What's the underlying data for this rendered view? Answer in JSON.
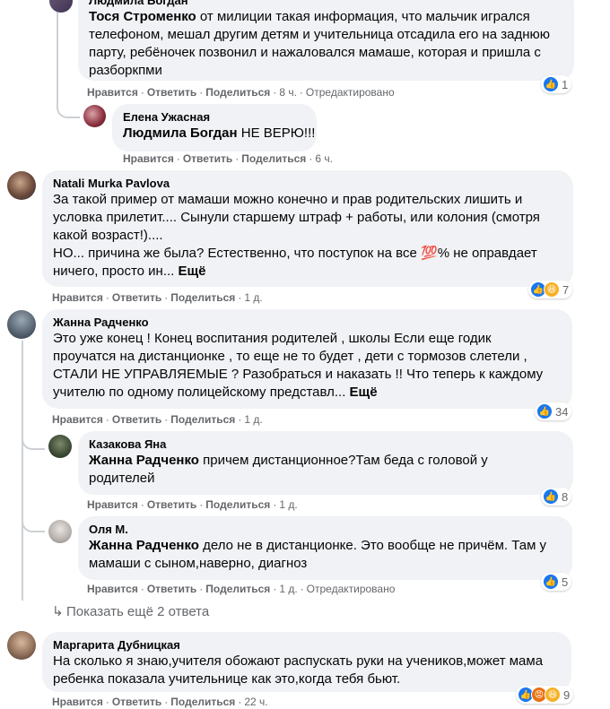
{
  "comments": [
    {
      "author": "Людмила Богдан",
      "mention": "Тося Строменко",
      "lines": [
        " от милиции такая информация, что мальчик игрался",
        "телефоном, мешал другим детям и учительница отсадила его на заднюю",
        "парту, ребёночек позвонил и нажаловался мамаше, которая и пришла с",
        "разборкпми"
      ],
      "actions": {
        "like": "Нравится",
        "reply": "Ответить",
        "share": "Поделиться",
        "time": "8 ч.",
        "edited": "Отредактировано"
      },
      "reactions": {
        "count": "1"
      }
    },
    {
      "author": "Елена Ужасная",
      "mention": "Людмила Богдан",
      "lines": [
        " НЕ ВЕРЮ!!!"
      ],
      "actions": {
        "like": "Нравится",
        "reply": "Ответить",
        "share": "Поделиться",
        "time": "6 ч."
      }
    },
    {
      "author": "Natali Murka Pavlova",
      "lines": [
        "За такой пример от мамаши можно конечно и прав родительских лишить и",
        "условка прилетит.... Сынули старшему штраф + работы, или колония (смотря",
        "какой возраст!)....",
        "НО... причина же была? Естественно, что поступок на все ",
        "% не оправдает",
        "ничего, просто ин..."
      ],
      "emoji": "💯",
      "more": "Ещё",
      "actions": {
        "like": "Нравится",
        "reply": "Ответить",
        "share": "Поделиться",
        "time": "1 д."
      },
      "reactions": {
        "count": "7"
      }
    },
    {
      "author": "Жанна Радченко",
      "lines": [
        "Это уже конец ! Конец воспитания родителей , школы Если еще годик",
        "проучатся на дистанционке , то еще не то будет , дети с тормозов слетели ,",
        "СТАЛИ НЕ УПРАВЛЯЕМЫЕ ? Разобраться и наказать !! Что теперь к каждому",
        "учителю по одному полицейскому представл..."
      ],
      "more": "Ещё",
      "actions": {
        "like": "Нравится",
        "reply": "Ответить",
        "share": "Поделиться",
        "time": "1 д."
      },
      "reactions": {
        "count": "34"
      }
    },
    {
      "author": "Казакова Яна",
      "mention": "Жанна Радченко",
      "lines": [
        " причем дистанционное?Там беда с головой у",
        "родителей"
      ],
      "actions": {
        "like": "Нравится",
        "reply": "Ответить",
        "share": "Поделиться",
        "time": "1 д."
      },
      "reactions": {
        "count": "8"
      }
    },
    {
      "author": "Оля М.",
      "mention": "Жанна Радченко",
      "lines": [
        " дело не в дистанционке. Это вообще не причём. Там у",
        "мамаши с сыном,наверно, диагноз"
      ],
      "actions": {
        "like": "Нравится",
        "reply": "Ответить",
        "share": "Поделиться",
        "time": "1 д.",
        "edited": "Отредактировано"
      },
      "reactions": {
        "count": "5"
      }
    },
    {
      "author": "Маргарита Дубницкая",
      "lines": [
        "На сколько я знаю,учителя обожают распускать руки на учеников,может мама",
        "ребенка показала учительнице как это,когда тебя бьют."
      ],
      "actions": {
        "like": "Нравится",
        "reply": "Ответить",
        "share": "Поделиться",
        "time": "22 ч."
      },
      "reactions": {
        "count": "9"
      }
    }
  ],
  "show_more_replies": "Показать ещё 2 ответа",
  "icons": {
    "like": "like-icon",
    "haha": "haha-icon",
    "angry": "angry-icon",
    "reply_arrow": "reply-arrow-icon"
  },
  "colors": {
    "bubble": "#f0f2f5",
    "meta": "#65676b",
    "like_blue": "#1877f2"
  }
}
